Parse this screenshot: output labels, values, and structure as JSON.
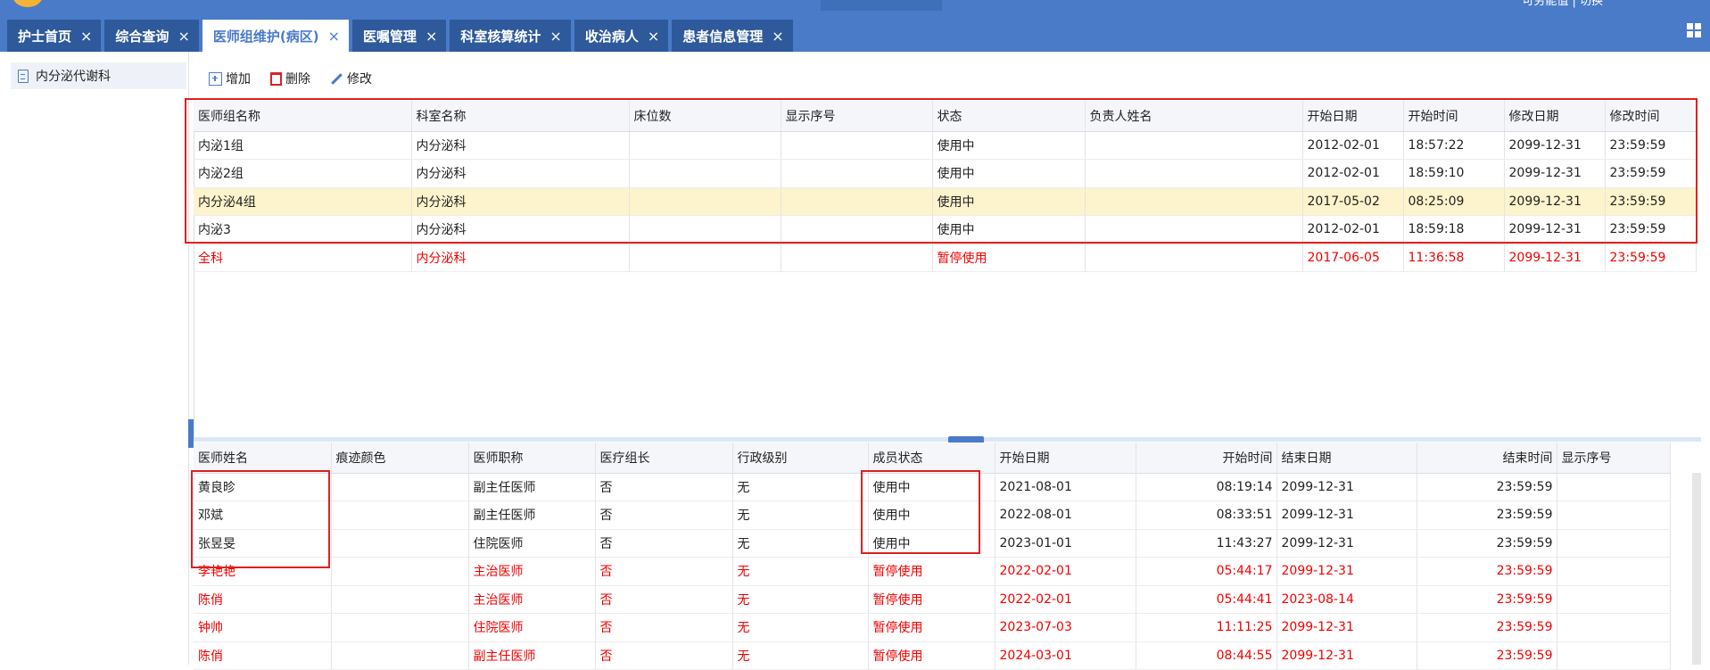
{
  "header": {
    "user_info": "可劳能值 | 切换"
  },
  "tabs": [
    {
      "label": "护士首页",
      "active": false
    },
    {
      "label": "综合查询",
      "active": false
    },
    {
      "label": "医师组维护(病区)",
      "active": true
    },
    {
      "label": "医嘱管理",
      "active": false
    },
    {
      "label": "科室核算统计",
      "active": false
    },
    {
      "label": "收治病人",
      "active": false
    },
    {
      "label": "患者信息管理",
      "active": false
    }
  ],
  "sidebar": {
    "items": [
      {
        "label": "内分泌代谢科"
      }
    ]
  },
  "toolbar": {
    "add_label": "增加",
    "delete_label": "删除",
    "edit_label": "修改"
  },
  "group_table": {
    "columns": [
      "医师组名称",
      "科室名称",
      "床位数",
      "显示序号",
      "状态",
      "负责人姓名",
      "开始日期",
      "开始时间",
      "修改日期",
      "修改时间"
    ],
    "rows": [
      {
        "name": "内泌1组",
        "dept": "内分泌科",
        "beds": "",
        "order": "",
        "status": "使用中",
        "leader": "",
        "start_date": "2012-02-01",
        "start_time": "18:57:22",
        "mod_date": "2099-12-31",
        "mod_time": "23:59:59",
        "style": ""
      },
      {
        "name": "内泌2组",
        "dept": "内分泌科",
        "beds": "",
        "order": "",
        "status": "使用中",
        "leader": "",
        "start_date": "2012-02-01",
        "start_time": "18:59:10",
        "mod_date": "2099-12-31",
        "mod_time": "23:59:59",
        "style": ""
      },
      {
        "name": "内分泌4组",
        "dept": "内分泌科",
        "beds": "",
        "order": "",
        "status": "使用中",
        "leader": "",
        "start_date": "2017-05-02",
        "start_time": "08:25:09",
        "mod_date": "2099-12-31",
        "mod_time": "23:59:59",
        "style": "highlight"
      },
      {
        "name": "内泌3",
        "dept": "内分泌科",
        "beds": "",
        "order": "",
        "status": "使用中",
        "leader": "",
        "start_date": "2012-02-01",
        "start_time": "18:59:18",
        "mod_date": "2099-12-31",
        "mod_time": "23:59:59",
        "style": ""
      },
      {
        "name": "全科",
        "dept": "内分泌科",
        "beds": "",
        "order": "",
        "status": "暂停使用",
        "leader": "",
        "start_date": "2017-06-05",
        "start_time": "11:36:58",
        "mod_date": "2099-12-31",
        "mod_time": "23:59:59",
        "style": "red"
      }
    ]
  },
  "member_table": {
    "columns": [
      "医师姓名",
      "痕迹颜色",
      "医师职称",
      "医疗组长",
      "行政级别",
      "成员状态",
      "开始日期",
      "开始时间",
      "结束日期",
      "结束时间",
      "显示序号"
    ],
    "rows": [
      {
        "name": "黄良昣",
        "color": "",
        "title": "副主任医师",
        "leader": "否",
        "level": "无",
        "status": "使用中",
        "start_date": "2021-08-01",
        "start_time": "08:19:14",
        "end_date": "2099-12-31",
        "end_time": "23:59:59",
        "order": "",
        "style": ""
      },
      {
        "name": "邓斌",
        "color": "",
        "title": "副主任医师",
        "leader": "否",
        "level": "无",
        "status": "使用中",
        "start_date": "2022-08-01",
        "start_time": "08:33:51",
        "end_date": "2099-12-31",
        "end_time": "23:59:59",
        "order": "",
        "style": ""
      },
      {
        "name": "张昱旻",
        "color": "",
        "title": "住院医师",
        "leader": "否",
        "level": "无",
        "status": "使用中",
        "start_date": "2023-01-01",
        "start_time": "11:43:27",
        "end_date": "2099-12-31",
        "end_time": "23:59:59",
        "order": "",
        "style": ""
      },
      {
        "name": "李艳艳",
        "color": "",
        "title": "主治医师",
        "leader": "否",
        "level": "无",
        "status": "暂停使用",
        "start_date": "2022-02-01",
        "start_time": "05:44:17",
        "end_date": "2099-12-31",
        "end_time": "23:59:59",
        "order": "",
        "style": "red"
      },
      {
        "name": "陈俏",
        "color": "",
        "title": "主治医师",
        "leader": "否",
        "level": "无",
        "status": "暂停使用",
        "start_date": "2022-02-01",
        "start_time": "05:44:41",
        "end_date": "2023-08-14",
        "end_time": "23:59:59",
        "order": "",
        "style": "red"
      },
      {
        "name": "钟帅",
        "color": "",
        "title": "住院医师",
        "leader": "否",
        "level": "无",
        "status": "暂停使用",
        "start_date": "2023-07-03",
        "start_time": "11:11:25",
        "end_date": "2099-12-31",
        "end_time": "23:59:59",
        "order": "",
        "style": "red"
      },
      {
        "name": "陈俏",
        "color": "",
        "title": "副主任医师",
        "leader": "否",
        "level": "无",
        "status": "暂停使用",
        "start_date": "2024-03-01",
        "start_time": "08:44:55",
        "end_date": "2099-12-31",
        "end_time": "23:59:59",
        "order": "",
        "style": "red"
      }
    ]
  },
  "colors": {
    "brand": "#4a7bc8",
    "tab_dark": "#2e5a9c",
    "inactive_text": "#f20000",
    "selected_row": "#fdf3cc",
    "annotation_box": "#e02020"
  }
}
